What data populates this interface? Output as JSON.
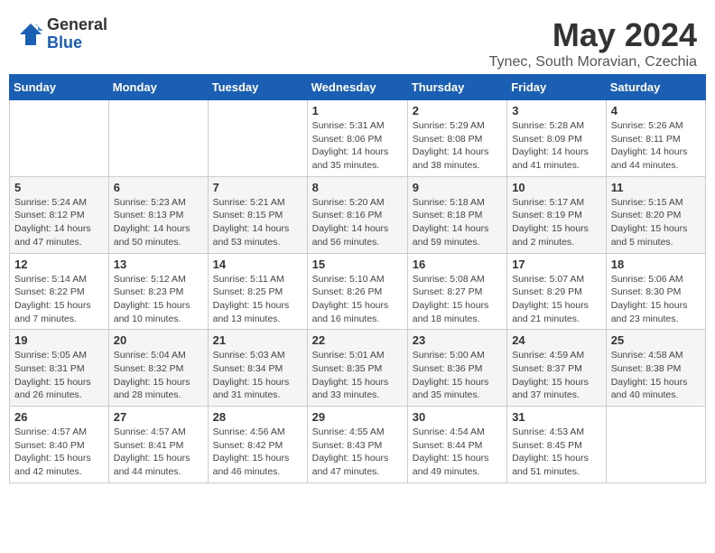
{
  "header": {
    "logo_general": "General",
    "logo_blue": "Blue",
    "month_title": "May 2024",
    "location": "Tynec, South Moravian, Czechia"
  },
  "weekdays": [
    "Sunday",
    "Monday",
    "Tuesday",
    "Wednesday",
    "Thursday",
    "Friday",
    "Saturday"
  ],
  "weeks": [
    [
      {
        "day": "",
        "info": ""
      },
      {
        "day": "",
        "info": ""
      },
      {
        "day": "",
        "info": ""
      },
      {
        "day": "1",
        "info": "Sunrise: 5:31 AM\nSunset: 8:06 PM\nDaylight: 14 hours\nand 35 minutes."
      },
      {
        "day": "2",
        "info": "Sunrise: 5:29 AM\nSunset: 8:08 PM\nDaylight: 14 hours\nand 38 minutes."
      },
      {
        "day": "3",
        "info": "Sunrise: 5:28 AM\nSunset: 8:09 PM\nDaylight: 14 hours\nand 41 minutes."
      },
      {
        "day": "4",
        "info": "Sunrise: 5:26 AM\nSunset: 8:11 PM\nDaylight: 14 hours\nand 44 minutes."
      }
    ],
    [
      {
        "day": "5",
        "info": "Sunrise: 5:24 AM\nSunset: 8:12 PM\nDaylight: 14 hours\nand 47 minutes."
      },
      {
        "day": "6",
        "info": "Sunrise: 5:23 AM\nSunset: 8:13 PM\nDaylight: 14 hours\nand 50 minutes."
      },
      {
        "day": "7",
        "info": "Sunrise: 5:21 AM\nSunset: 8:15 PM\nDaylight: 14 hours\nand 53 minutes."
      },
      {
        "day": "8",
        "info": "Sunrise: 5:20 AM\nSunset: 8:16 PM\nDaylight: 14 hours\nand 56 minutes."
      },
      {
        "day": "9",
        "info": "Sunrise: 5:18 AM\nSunset: 8:18 PM\nDaylight: 14 hours\nand 59 minutes."
      },
      {
        "day": "10",
        "info": "Sunrise: 5:17 AM\nSunset: 8:19 PM\nDaylight: 15 hours\nand 2 minutes."
      },
      {
        "day": "11",
        "info": "Sunrise: 5:15 AM\nSunset: 8:20 PM\nDaylight: 15 hours\nand 5 minutes."
      }
    ],
    [
      {
        "day": "12",
        "info": "Sunrise: 5:14 AM\nSunset: 8:22 PM\nDaylight: 15 hours\nand 7 minutes."
      },
      {
        "day": "13",
        "info": "Sunrise: 5:12 AM\nSunset: 8:23 PM\nDaylight: 15 hours\nand 10 minutes."
      },
      {
        "day": "14",
        "info": "Sunrise: 5:11 AM\nSunset: 8:25 PM\nDaylight: 15 hours\nand 13 minutes."
      },
      {
        "day": "15",
        "info": "Sunrise: 5:10 AM\nSunset: 8:26 PM\nDaylight: 15 hours\nand 16 minutes."
      },
      {
        "day": "16",
        "info": "Sunrise: 5:08 AM\nSunset: 8:27 PM\nDaylight: 15 hours\nand 18 minutes."
      },
      {
        "day": "17",
        "info": "Sunrise: 5:07 AM\nSunset: 8:29 PM\nDaylight: 15 hours\nand 21 minutes."
      },
      {
        "day": "18",
        "info": "Sunrise: 5:06 AM\nSunset: 8:30 PM\nDaylight: 15 hours\nand 23 minutes."
      }
    ],
    [
      {
        "day": "19",
        "info": "Sunrise: 5:05 AM\nSunset: 8:31 PM\nDaylight: 15 hours\nand 26 minutes."
      },
      {
        "day": "20",
        "info": "Sunrise: 5:04 AM\nSunset: 8:32 PM\nDaylight: 15 hours\nand 28 minutes."
      },
      {
        "day": "21",
        "info": "Sunrise: 5:03 AM\nSunset: 8:34 PM\nDaylight: 15 hours\nand 31 minutes."
      },
      {
        "day": "22",
        "info": "Sunrise: 5:01 AM\nSunset: 8:35 PM\nDaylight: 15 hours\nand 33 minutes."
      },
      {
        "day": "23",
        "info": "Sunrise: 5:00 AM\nSunset: 8:36 PM\nDaylight: 15 hours\nand 35 minutes."
      },
      {
        "day": "24",
        "info": "Sunrise: 4:59 AM\nSunset: 8:37 PM\nDaylight: 15 hours\nand 37 minutes."
      },
      {
        "day": "25",
        "info": "Sunrise: 4:58 AM\nSunset: 8:38 PM\nDaylight: 15 hours\nand 40 minutes."
      }
    ],
    [
      {
        "day": "26",
        "info": "Sunrise: 4:57 AM\nSunset: 8:40 PM\nDaylight: 15 hours\nand 42 minutes."
      },
      {
        "day": "27",
        "info": "Sunrise: 4:57 AM\nSunset: 8:41 PM\nDaylight: 15 hours\nand 44 minutes."
      },
      {
        "day": "28",
        "info": "Sunrise: 4:56 AM\nSunset: 8:42 PM\nDaylight: 15 hours\nand 46 minutes."
      },
      {
        "day": "29",
        "info": "Sunrise: 4:55 AM\nSunset: 8:43 PM\nDaylight: 15 hours\nand 47 minutes."
      },
      {
        "day": "30",
        "info": "Sunrise: 4:54 AM\nSunset: 8:44 PM\nDaylight: 15 hours\nand 49 minutes."
      },
      {
        "day": "31",
        "info": "Sunrise: 4:53 AM\nSunset: 8:45 PM\nDaylight: 15 hours\nand 51 minutes."
      },
      {
        "day": "",
        "info": ""
      }
    ]
  ]
}
